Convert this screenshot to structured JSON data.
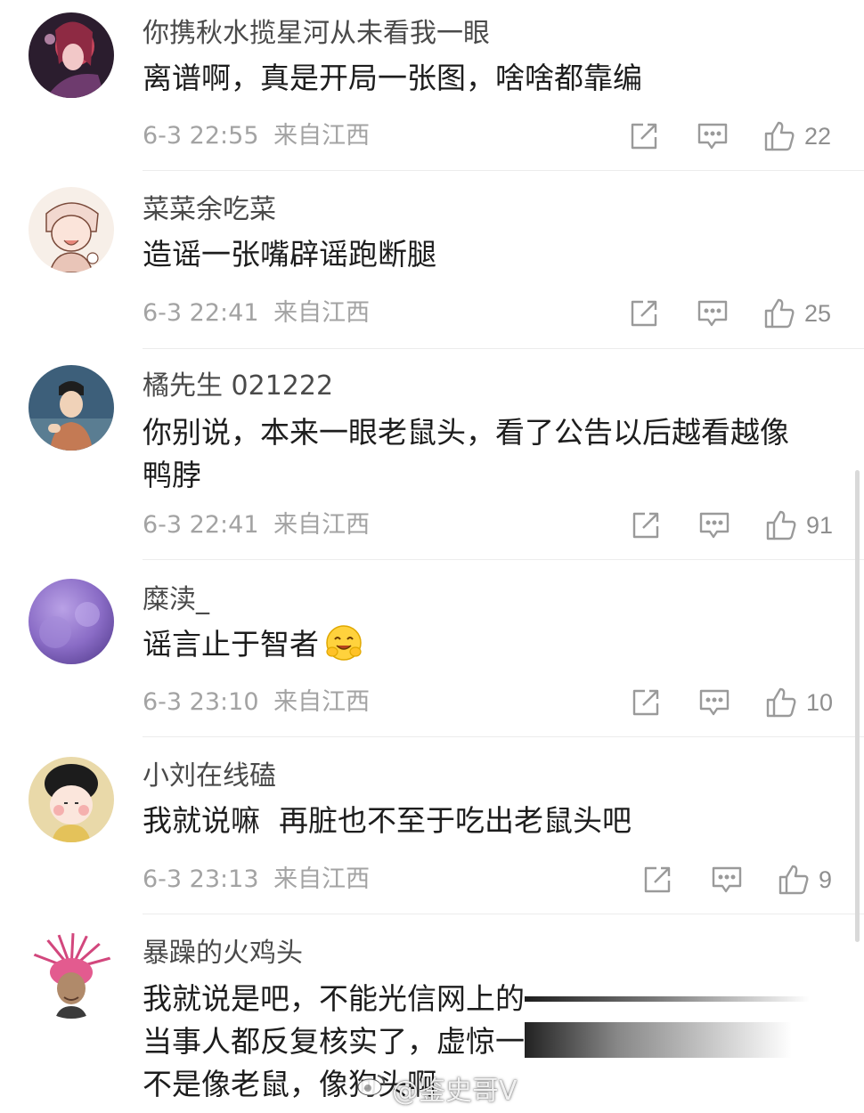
{
  "comments": [
    {
      "username": "你携秋水揽星河从未看我一眼",
      "lines": [
        "离谱啊，真是开局一张图，啥啥都靠编"
      ],
      "date": "6-3 22:55",
      "location": "来自江西",
      "likes": "22"
    },
    {
      "username": "菜菜余吃菜",
      "lines": [
        "造谣一张嘴辟谣跑断腿"
      ],
      "date": "6-3 22:41",
      "location": "来自江西",
      "likes": "25"
    },
    {
      "username": "橘先生 021222",
      "lines": [
        "你别说，本来一眼老鼠头，看了公告以后越看越像",
        "鸭脖"
      ],
      "date": "6-3 22:41",
      "location": "来自江西",
      "likes": "91"
    },
    {
      "username": "糜渎_",
      "lines": [
        "谣言止于智者"
      ],
      "date": "6-3 23:10",
      "location": "来自江西",
      "likes": "10"
    },
    {
      "username": "小刘在线磕",
      "lines": [
        "我就说嘛  再脏也不至于吃出老鼠头吧"
      ],
      "date": "6-3 23:13",
      "location": "来自江西",
      "likes": "9"
    },
    {
      "username": "暴躁的火鸡头",
      "lines": [
        "我就说是吧，不能光信网上的",
        "当事人都反复核实了，虚惊一",
        "不是像老鼠，像狗头啊"
      ]
    }
  ],
  "watermark": "@鉴史哥V",
  "icons": {
    "share": "share-icon",
    "comment": "comment-icon",
    "like": "thumbs-up-icon"
  },
  "colors": {
    "text": "#1d1d1d",
    "username": "#4a4a4a",
    "meta": "#a3a3a3",
    "icon": "#9a9a9a"
  }
}
